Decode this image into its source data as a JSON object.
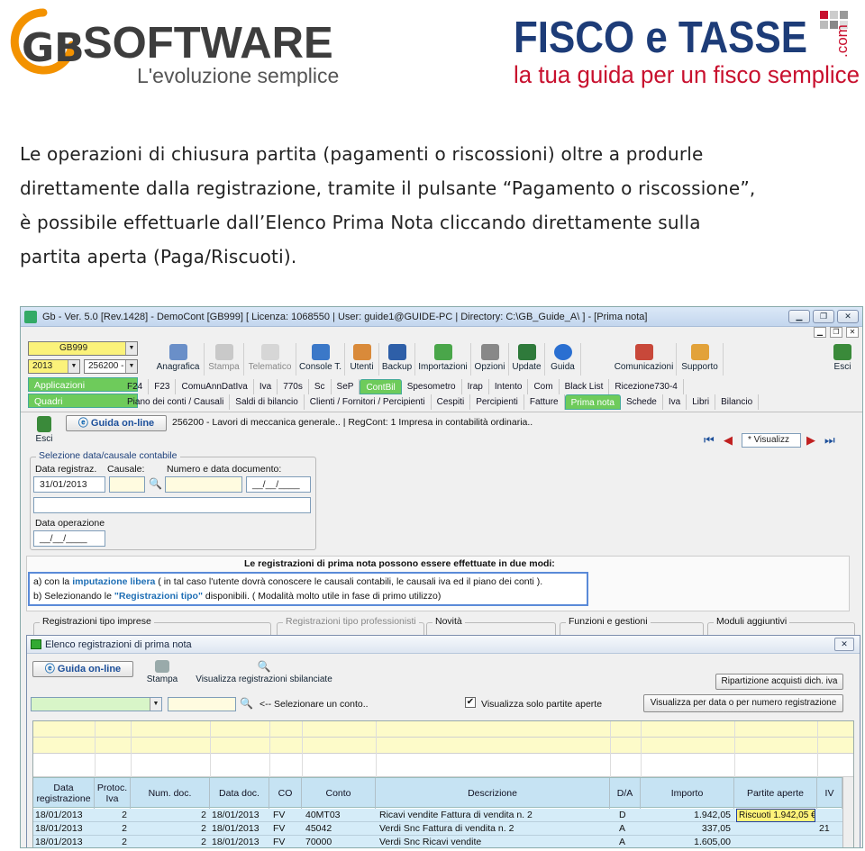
{
  "header": {
    "gb_logo_text": "SOFTWARE",
    "gb_logo_mark": "GB",
    "gb_tagline": "L'evoluzione semplice",
    "fisco_logo_text": "FISCO e TASSE",
    "fisco_logo_com": ".com",
    "fisco_tagline": "la tua guida per un fisco semplice"
  },
  "intro": {
    "line1": "Le operazioni di chiusura partita (pagamenti o riscossioni) oltre a produrle",
    "line2": "direttamente dalla registrazione, tramite il pulsante “Pagamento o riscossione”,",
    "line3": "è possibile effettuarle dall’Elenco Prima Nota cliccando direttamente sulla",
    "line4": "partita aperta (Paga/Riscuoti)."
  },
  "app": {
    "title": "Gb - Ver. 5.0 [Rev.1428] - DemoCont [GB999]    [ Licenza: 1068550 | User: guide1@GUIDE-PC | Directory: C:\\GB_Guide_A\\ ] - [Prima nota]",
    "company_select": "GB999",
    "year_select": "2013",
    "activity_select": "256200 -",
    "applicazioni": "Applicazioni",
    "quadri": "Quadri",
    "toolbar": [
      "Anagrafica",
      "Stampa",
      "Telematico",
      "Console T.",
      "Utenti",
      "Backup",
      "Importazioni",
      "Opzioni",
      "Update",
      "Guida"
    ],
    "toolbar_right": [
      "Comunicazioni",
      "Supporto"
    ],
    "esci": "Esci",
    "tabs_row1": [
      "F24",
      "F23",
      "ComuAnnDatIva",
      "Iva",
      "770s",
      "Sc",
      "SeP",
      "ContBil",
      "Spesometro",
      "Irap",
      "Intento",
      "Com",
      "Black List",
      "Ricezione730-4"
    ],
    "tabs_row2": [
      "Piano dei conti / Causali",
      "Saldi di bilancio",
      "Clienti / Fornitori / Percipienti",
      "Cespiti",
      "Percipienti",
      "Fatture",
      "Prima nota",
      "Schede",
      "Iva",
      "Libri",
      "Bilancio"
    ],
    "active_tab1": "ContBil",
    "active_tab2": "Prima nota"
  },
  "prima_nota": {
    "esci": "Esci",
    "guida": "Guida on-line",
    "info": "256200 - Lavori di meccanica generale.. | RegCont: 1 Impresa in contabilità ordinaria..",
    "visualizza": "* Visualizz",
    "group_title": "Selezione data/causale contabile",
    "data_registraz_label": "Data registraz.",
    "causale_label": "Causale:",
    "numero_data_label": "Numero e data documento:",
    "data_registraz": "31/01/2013",
    "doc_date": "__/__/____",
    "data_operazione_label": "Data operazione",
    "data_operazione": "__/__/____",
    "info_title": "Le registrazioni di prima nota possono essere effettuate in due modi:",
    "info_a_prefix": "a) con la ",
    "info_a_link": "imputazione libera",
    "info_a_suffix": " ( in tal caso l'utente dovrà conoscere le causali contabili, le causali iva ed il piano dei conti ).",
    "info_b_prefix": "b) Selezionando le ",
    "info_b_link": "\"Registrazioni tipo\"",
    "info_b_suffix": " disponibili. ( Modalità molto utile in fase di primo utilizzo)",
    "groups": [
      "Registrazioni tipo imprese",
      "Registrazioni tipo professionisti",
      "Novità",
      "Funzioni e gestioni",
      "Moduli aggiuntivi"
    ]
  },
  "elenco": {
    "title": "Elenco registrazioni di prima nota",
    "guida": "Guida on-line",
    "stampa": "Stampa",
    "sbilanciate": "Visualizza registrazioni sbilanciate",
    "ripartizione": "Ripartizione acquisti dich. iva",
    "conto_hint": "<-- Selezionare un conto..",
    "solo_aperte": "Visualizza solo partite aperte",
    "per_data": "Visualizza per data o per numero registrazione",
    "columns": [
      "Data registrazione",
      "Protoc. Iva",
      "Num. doc.",
      "Data doc.",
      "CO",
      "Conto",
      "Descrizione",
      "D/A",
      "Importo",
      "Partite aperte",
      "IV"
    ],
    "rows": [
      [
        "18/01/2013",
        "2",
        "2",
        "18/01/2013",
        "FV",
        "40MT03",
        "Ricavi vendite Fattura di vendita n. 2",
        "D",
        "1.942,05",
        "Riscuoti 1.942,05 €",
        ""
      ],
      [
        "18/01/2013",
        "2",
        "2",
        "18/01/2013",
        "FV",
        "45042",
        "Verdi Snc Fattura di vendita n. 2",
        "A",
        "337,05",
        "",
        "21"
      ],
      [
        "18/01/2013",
        "2",
        "2",
        "18/01/2013",
        "FV",
        "70000",
        "Verdi Snc Ricavi vendite",
        "A",
        "1.605,00",
        "",
        ""
      ]
    ]
  },
  "colors": {
    "gb_orange": "#f39200",
    "gb_grey": "#3d3d3d",
    "fisco_blue": "#1d3c78",
    "fisco_red": "#c8102e",
    "active_green": "#6ecb5b",
    "row_blue": "#d5ecf8",
    "link_blue": "#1f6fb5"
  }
}
